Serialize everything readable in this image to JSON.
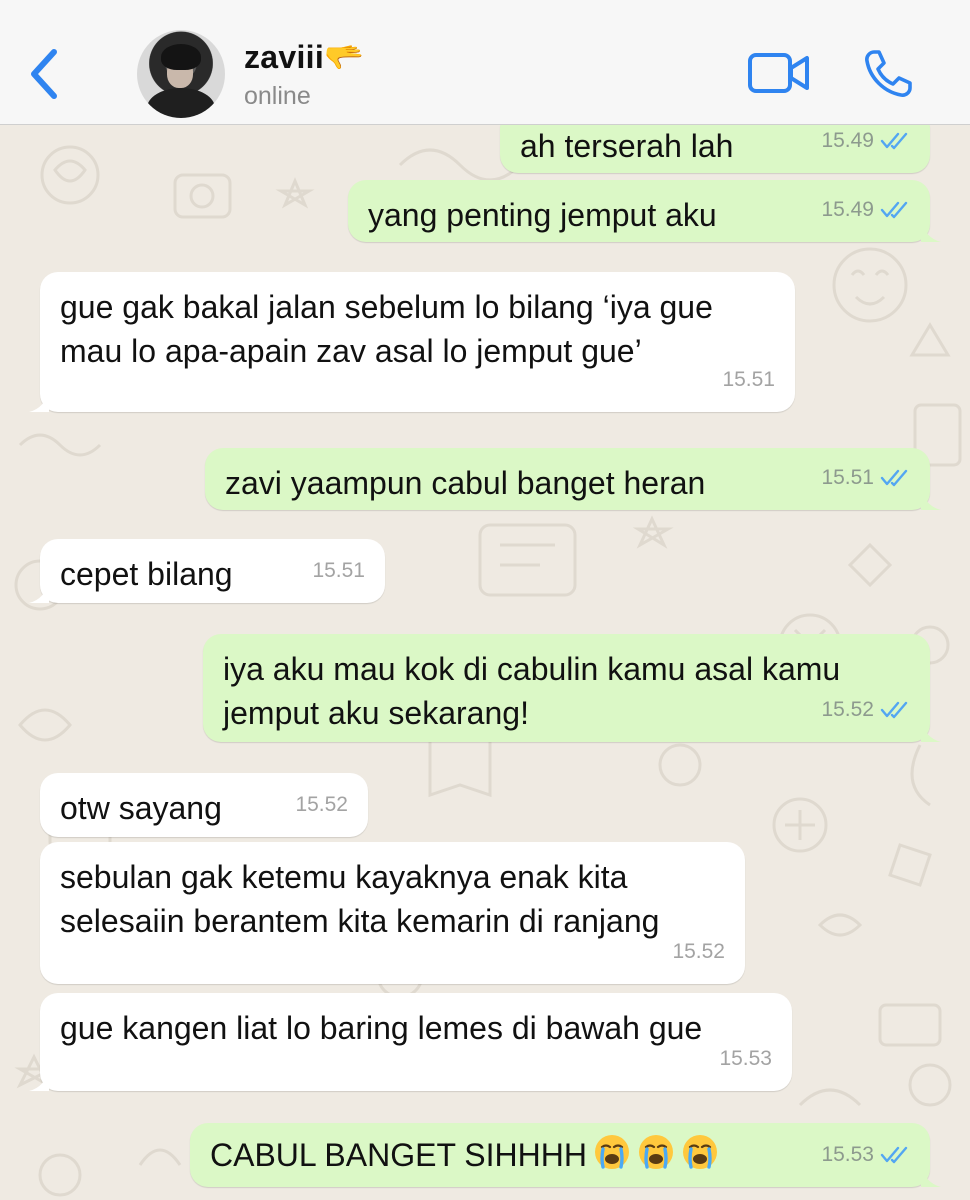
{
  "header": {
    "contact_name": "zaviii🫳",
    "status": "online"
  },
  "colors": {
    "accent": "#2f84f0",
    "outgoing_bubble": "#dbf8c6",
    "incoming_bubble": "#ffffff",
    "chat_background": "#efeae2",
    "read_ticks": "#53a6f2"
  },
  "icons": {
    "back": "chevron-left-icon",
    "video": "video-camera-icon",
    "call": "phone-icon",
    "read_receipt": "double-check-icon",
    "emoji": "loudly-crying-face-emoji"
  },
  "messages": [
    {
      "direction": "out",
      "text": "ah terserah lah",
      "time": "15.49",
      "read": true
    },
    {
      "direction": "out",
      "text": "yang penting jemput aku",
      "time": "15.49",
      "read": true
    },
    {
      "direction": "in",
      "text": "gue gak bakal jalan sebelum lo bilang ‘iya gue mau lo apa-apain zav asal lo jemput gue’",
      "time": "15.51"
    },
    {
      "direction": "out",
      "text": "zavi yaampun cabul banget heran",
      "time": "15.51",
      "read": true
    },
    {
      "direction": "in",
      "text": "cepet bilang",
      "time": "15.51"
    },
    {
      "direction": "out",
      "text": "iya aku mau kok di cabulin kamu asal kamu jemput aku sekarang!",
      "time": "15.52",
      "read": true
    },
    {
      "direction": "in",
      "text": "otw sayang",
      "time": "15.52"
    },
    {
      "direction": "in",
      "text": "sebulan gak ketemu kayaknya enak kita selesaiin berantem kita kemarin di ranjang",
      "time": "15.52"
    },
    {
      "direction": "in",
      "text": "gue kangen liat lo baring lemes di bawah gue",
      "time": "15.53"
    },
    {
      "direction": "out",
      "text": "CABUL BANGET SIHHHH",
      "emoji_count": 3,
      "time": "15.53",
      "read": true
    }
  ]
}
